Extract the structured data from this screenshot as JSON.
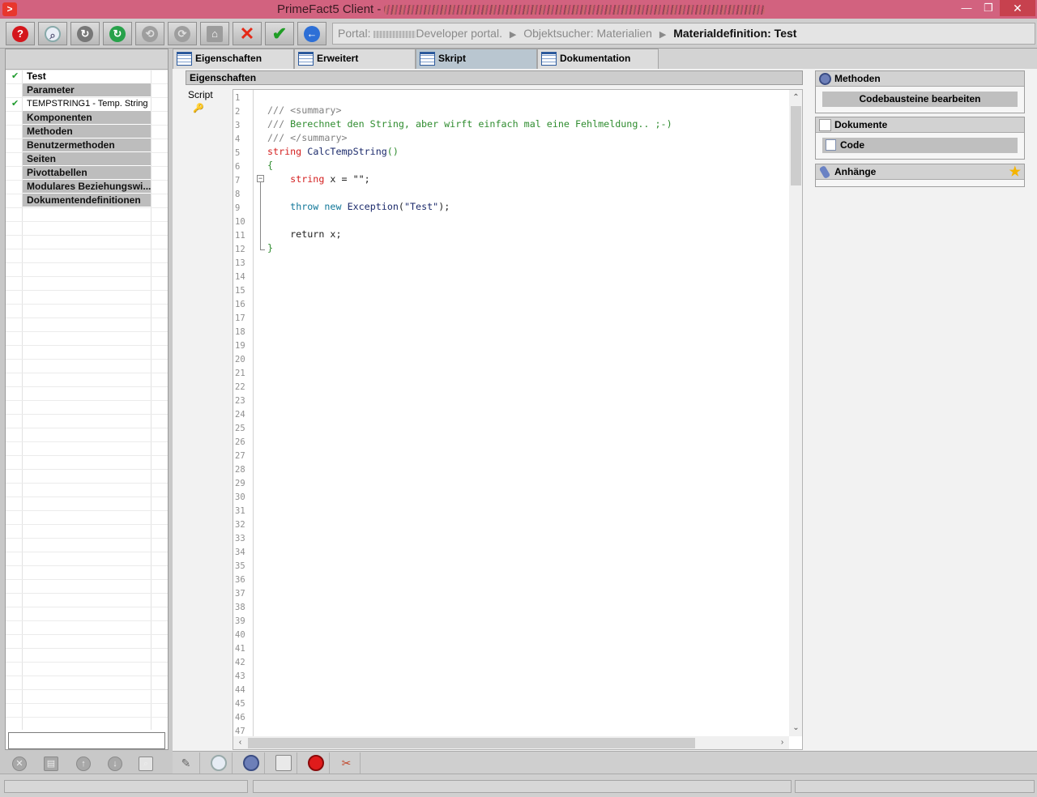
{
  "window": {
    "title": "PrimeFact5 Client -",
    "controls": {
      "minimize": "—",
      "maximize": "❐",
      "close": "✕"
    }
  },
  "toolbar": {
    "buttons": [
      {
        "name": "help-icon",
        "glyph": "?"
      },
      {
        "name": "search-icon",
        "glyph": "⌕"
      },
      {
        "name": "reload-icon",
        "glyph": "↻"
      },
      {
        "name": "refresh-icon",
        "glyph": "↻"
      },
      {
        "name": "nav-disabled-icon",
        "glyph": "⟲"
      },
      {
        "name": "nav-disabled-icon",
        "glyph": "⟳"
      },
      {
        "name": "home-icon",
        "glyph": "⌂"
      },
      {
        "name": "cancel-icon",
        "glyph": "✕"
      },
      {
        "name": "confirm-icon",
        "glyph": "✔"
      },
      {
        "name": "back-icon",
        "glyph": "←"
      }
    ]
  },
  "breadcrumb": {
    "portal_prefix": "Portal:",
    "portal_suffix": "Developer portal.",
    "separator": "▶",
    "objektsucher": "Objektsucher: Materialien",
    "current": "Materialdefinition: Test"
  },
  "tree": {
    "root": "Test",
    "items": [
      {
        "label": "Parameter",
        "kind": "cat"
      },
      {
        "label": "TEMPSTRING1 - Temp. String",
        "kind": "leaf",
        "checked": true
      },
      {
        "label": "Komponenten",
        "kind": "cat"
      },
      {
        "label": "Methoden",
        "kind": "cat"
      },
      {
        "label": "Benutzermethoden",
        "kind": "cat"
      },
      {
        "label": "Seiten",
        "kind": "cat"
      },
      {
        "label": "Pivottabellen",
        "kind": "cat"
      },
      {
        "label": "Modulares Beziehungswi...",
        "kind": "cat"
      },
      {
        "label": "Dokumentendefinitionen",
        "kind": "cat"
      }
    ],
    "filter_value": ""
  },
  "tabs": [
    {
      "label": "Eigenschaften",
      "active": false
    },
    {
      "label": "Erweitert",
      "active": false
    },
    {
      "label": "Skript",
      "active": true
    },
    {
      "label": "Dokumentation",
      "active": false
    }
  ],
  "properties": {
    "header": "Eigenschaften",
    "script_label": "Script"
  },
  "editor": {
    "line_count": 47,
    "code": [
      "",
      "/// <summary>",
      "/// Berechnet den String, aber wirft einfach mal eine Fehlmeldung.. ;-)",
      "/// </summary>",
      "string CalcTempString()",
      "{",
      "    string x = \"\";",
      "",
      "    throw new Exception(\"Test\");",
      "",
      "    return x;",
      "}"
    ]
  },
  "right_panel": {
    "methoden": {
      "title": "Methoden",
      "item": "Codebausteine bearbeiten"
    },
    "dokumente": {
      "title": "Dokumente",
      "item": "Code"
    },
    "anhaenge": {
      "title": "Anhänge"
    }
  },
  "colors": {
    "titlebar": "#d2627f",
    "comment": "#2f8c2f",
    "keyword": "#d42020",
    "active_tab": "#b9c6d0"
  }
}
